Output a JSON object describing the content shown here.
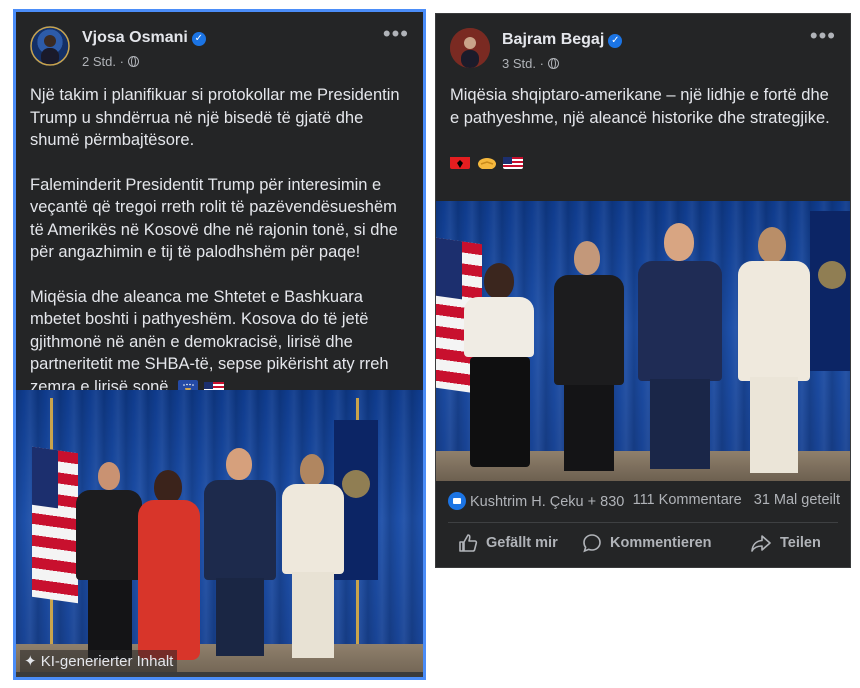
{
  "posts": [
    {
      "author": "Vjosa Osmani",
      "time": "2 Std.",
      "paragraphs": [
        "Një takim i planifikuar si protokollar me Presidentin Trump u shndërrua në një bisedë të gjatë dhe shumë përmbajtësore.",
        "Faleminderit Presidentit Trump për interesimin e veçantë që tregoi rreth rolit të pazëvendësueshëm të Amerikës në Kosovë dhe në rajonin tonë, si dhe për angazhimin e tij të palodhshëm për paqe!",
        "Miqësia dhe aleanca me Shtetet e Bashkuara mbetet boshti i pathyeshëm. Kosova do të jetë gjithmonë në anën e demokracisë, lirisë dhe partneritetit me SHBA-të, sepse pikërisht aty rreh zemra e lirisë sonë."
      ],
      "flags": [
        "kosovo-flag",
        "us-flag"
      ],
      "ai_label": "KI-generierter Inhalt"
    },
    {
      "author": "Bajram Begaj",
      "time": "3 Std.",
      "paragraphs": [
        "Miqësia shqiptaro-amerikane – një lidhje e fortë dhe e pathyeshme, një aleancë historike dhe strategjike."
      ],
      "flags": [
        "albania-flag",
        "handshake-emoji",
        "us-flag"
      ],
      "reactions": "Kushtrim H. Çeku + 830",
      "comments": "111 Kommentare",
      "shares": "31 Mal geteilt",
      "actions": {
        "like": "Gefällt mir",
        "comment": "Kommentieren",
        "share": "Teilen"
      }
    }
  ],
  "colors": {
    "card_bg": "#242526",
    "text": "#e4e6eb",
    "muted": "#b0b3b8",
    "accent": "#1b74e4",
    "highlight_border": "#4b8df8"
  }
}
